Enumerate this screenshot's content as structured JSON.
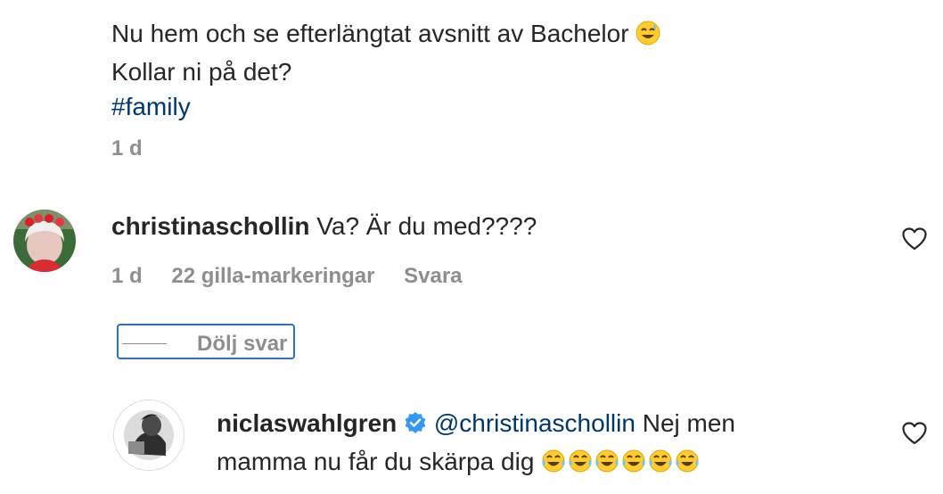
{
  "post": {
    "caption_line1": "Nu hem och se efterlängtat avsnitt av Bachelor",
    "caption_line2": "Kollar ni på det?",
    "hashtag": "#family",
    "time": "1 d"
  },
  "comment": {
    "username": "christinaschollin",
    "text": "Va? Är du med????",
    "time": "1 d",
    "likes": "22 gilla-markeringar",
    "reply_label": "Svara"
  },
  "hide_replies_label": "Dölj svar",
  "reply": {
    "username": "niclaswahlgren",
    "verified": true,
    "mention": "@christinaschollin",
    "text_part1": "Nej men",
    "text_part2": "mamma nu får du skärpa dig"
  },
  "colors": {
    "text": "#262626",
    "meta": "#8e8e8e",
    "link": "#00376b",
    "verified": "#3897f0",
    "focus_ring": "#2f6dd6"
  },
  "icons": [
    "sweat-smile-emoji-icon",
    "heart-icon",
    "verified-badge-icon",
    "tears-of-joy-emoji-icon"
  ]
}
